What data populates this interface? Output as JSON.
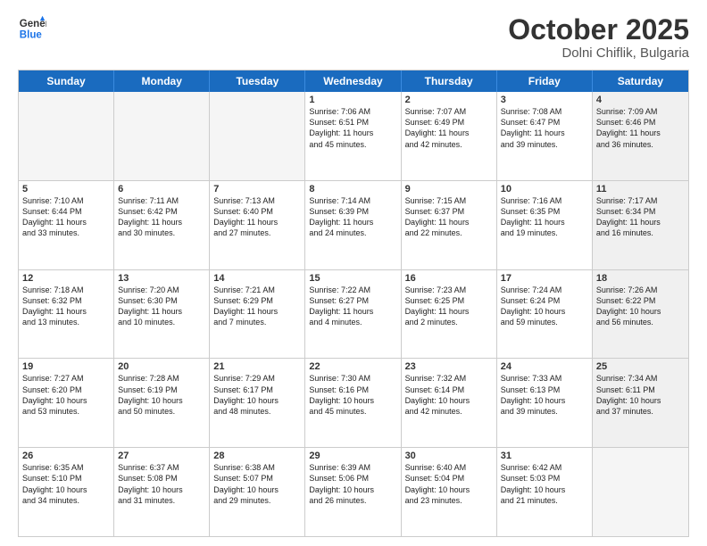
{
  "header": {
    "logo_line1": "General",
    "logo_line2": "Blue",
    "month": "October 2025",
    "location": "Dolni Chiflik, Bulgaria"
  },
  "days_of_week": [
    "Sunday",
    "Monday",
    "Tuesday",
    "Wednesday",
    "Thursday",
    "Friday",
    "Saturday"
  ],
  "rows": [
    [
      {
        "day": "",
        "text": "",
        "empty": true
      },
      {
        "day": "",
        "text": "",
        "empty": true
      },
      {
        "day": "",
        "text": "",
        "empty": true
      },
      {
        "day": "1",
        "text": "Sunrise: 7:06 AM\nSunset: 6:51 PM\nDaylight: 11 hours\nand 45 minutes."
      },
      {
        "day": "2",
        "text": "Sunrise: 7:07 AM\nSunset: 6:49 PM\nDaylight: 11 hours\nand 42 minutes."
      },
      {
        "day": "3",
        "text": "Sunrise: 7:08 AM\nSunset: 6:47 PM\nDaylight: 11 hours\nand 39 minutes."
      },
      {
        "day": "4",
        "text": "Sunrise: 7:09 AM\nSunset: 6:46 PM\nDaylight: 11 hours\nand 36 minutes.",
        "shaded": true
      }
    ],
    [
      {
        "day": "5",
        "text": "Sunrise: 7:10 AM\nSunset: 6:44 PM\nDaylight: 11 hours\nand 33 minutes."
      },
      {
        "day": "6",
        "text": "Sunrise: 7:11 AM\nSunset: 6:42 PM\nDaylight: 11 hours\nand 30 minutes."
      },
      {
        "day": "7",
        "text": "Sunrise: 7:13 AM\nSunset: 6:40 PM\nDaylight: 11 hours\nand 27 minutes."
      },
      {
        "day": "8",
        "text": "Sunrise: 7:14 AM\nSunset: 6:39 PM\nDaylight: 11 hours\nand 24 minutes."
      },
      {
        "day": "9",
        "text": "Sunrise: 7:15 AM\nSunset: 6:37 PM\nDaylight: 11 hours\nand 22 minutes."
      },
      {
        "day": "10",
        "text": "Sunrise: 7:16 AM\nSunset: 6:35 PM\nDaylight: 11 hours\nand 19 minutes."
      },
      {
        "day": "11",
        "text": "Sunrise: 7:17 AM\nSunset: 6:34 PM\nDaylight: 11 hours\nand 16 minutes.",
        "shaded": true
      }
    ],
    [
      {
        "day": "12",
        "text": "Sunrise: 7:18 AM\nSunset: 6:32 PM\nDaylight: 11 hours\nand 13 minutes."
      },
      {
        "day": "13",
        "text": "Sunrise: 7:20 AM\nSunset: 6:30 PM\nDaylight: 11 hours\nand 10 minutes."
      },
      {
        "day": "14",
        "text": "Sunrise: 7:21 AM\nSunset: 6:29 PM\nDaylight: 11 hours\nand 7 minutes."
      },
      {
        "day": "15",
        "text": "Sunrise: 7:22 AM\nSunset: 6:27 PM\nDaylight: 11 hours\nand 4 minutes."
      },
      {
        "day": "16",
        "text": "Sunrise: 7:23 AM\nSunset: 6:25 PM\nDaylight: 11 hours\nand 2 minutes."
      },
      {
        "day": "17",
        "text": "Sunrise: 7:24 AM\nSunset: 6:24 PM\nDaylight: 10 hours\nand 59 minutes."
      },
      {
        "day": "18",
        "text": "Sunrise: 7:26 AM\nSunset: 6:22 PM\nDaylight: 10 hours\nand 56 minutes.",
        "shaded": true
      }
    ],
    [
      {
        "day": "19",
        "text": "Sunrise: 7:27 AM\nSunset: 6:20 PM\nDaylight: 10 hours\nand 53 minutes."
      },
      {
        "day": "20",
        "text": "Sunrise: 7:28 AM\nSunset: 6:19 PM\nDaylight: 10 hours\nand 50 minutes."
      },
      {
        "day": "21",
        "text": "Sunrise: 7:29 AM\nSunset: 6:17 PM\nDaylight: 10 hours\nand 48 minutes."
      },
      {
        "day": "22",
        "text": "Sunrise: 7:30 AM\nSunset: 6:16 PM\nDaylight: 10 hours\nand 45 minutes."
      },
      {
        "day": "23",
        "text": "Sunrise: 7:32 AM\nSunset: 6:14 PM\nDaylight: 10 hours\nand 42 minutes."
      },
      {
        "day": "24",
        "text": "Sunrise: 7:33 AM\nSunset: 6:13 PM\nDaylight: 10 hours\nand 39 minutes."
      },
      {
        "day": "25",
        "text": "Sunrise: 7:34 AM\nSunset: 6:11 PM\nDaylight: 10 hours\nand 37 minutes.",
        "shaded": true
      }
    ],
    [
      {
        "day": "26",
        "text": "Sunrise: 6:35 AM\nSunset: 5:10 PM\nDaylight: 10 hours\nand 34 minutes."
      },
      {
        "day": "27",
        "text": "Sunrise: 6:37 AM\nSunset: 5:08 PM\nDaylight: 10 hours\nand 31 minutes."
      },
      {
        "day": "28",
        "text": "Sunrise: 6:38 AM\nSunset: 5:07 PM\nDaylight: 10 hours\nand 29 minutes."
      },
      {
        "day": "29",
        "text": "Sunrise: 6:39 AM\nSunset: 5:06 PM\nDaylight: 10 hours\nand 26 minutes."
      },
      {
        "day": "30",
        "text": "Sunrise: 6:40 AM\nSunset: 5:04 PM\nDaylight: 10 hours\nand 23 minutes."
      },
      {
        "day": "31",
        "text": "Sunrise: 6:42 AM\nSunset: 5:03 PM\nDaylight: 10 hours\nand 21 minutes."
      },
      {
        "day": "",
        "text": "",
        "empty": true
      }
    ]
  ]
}
